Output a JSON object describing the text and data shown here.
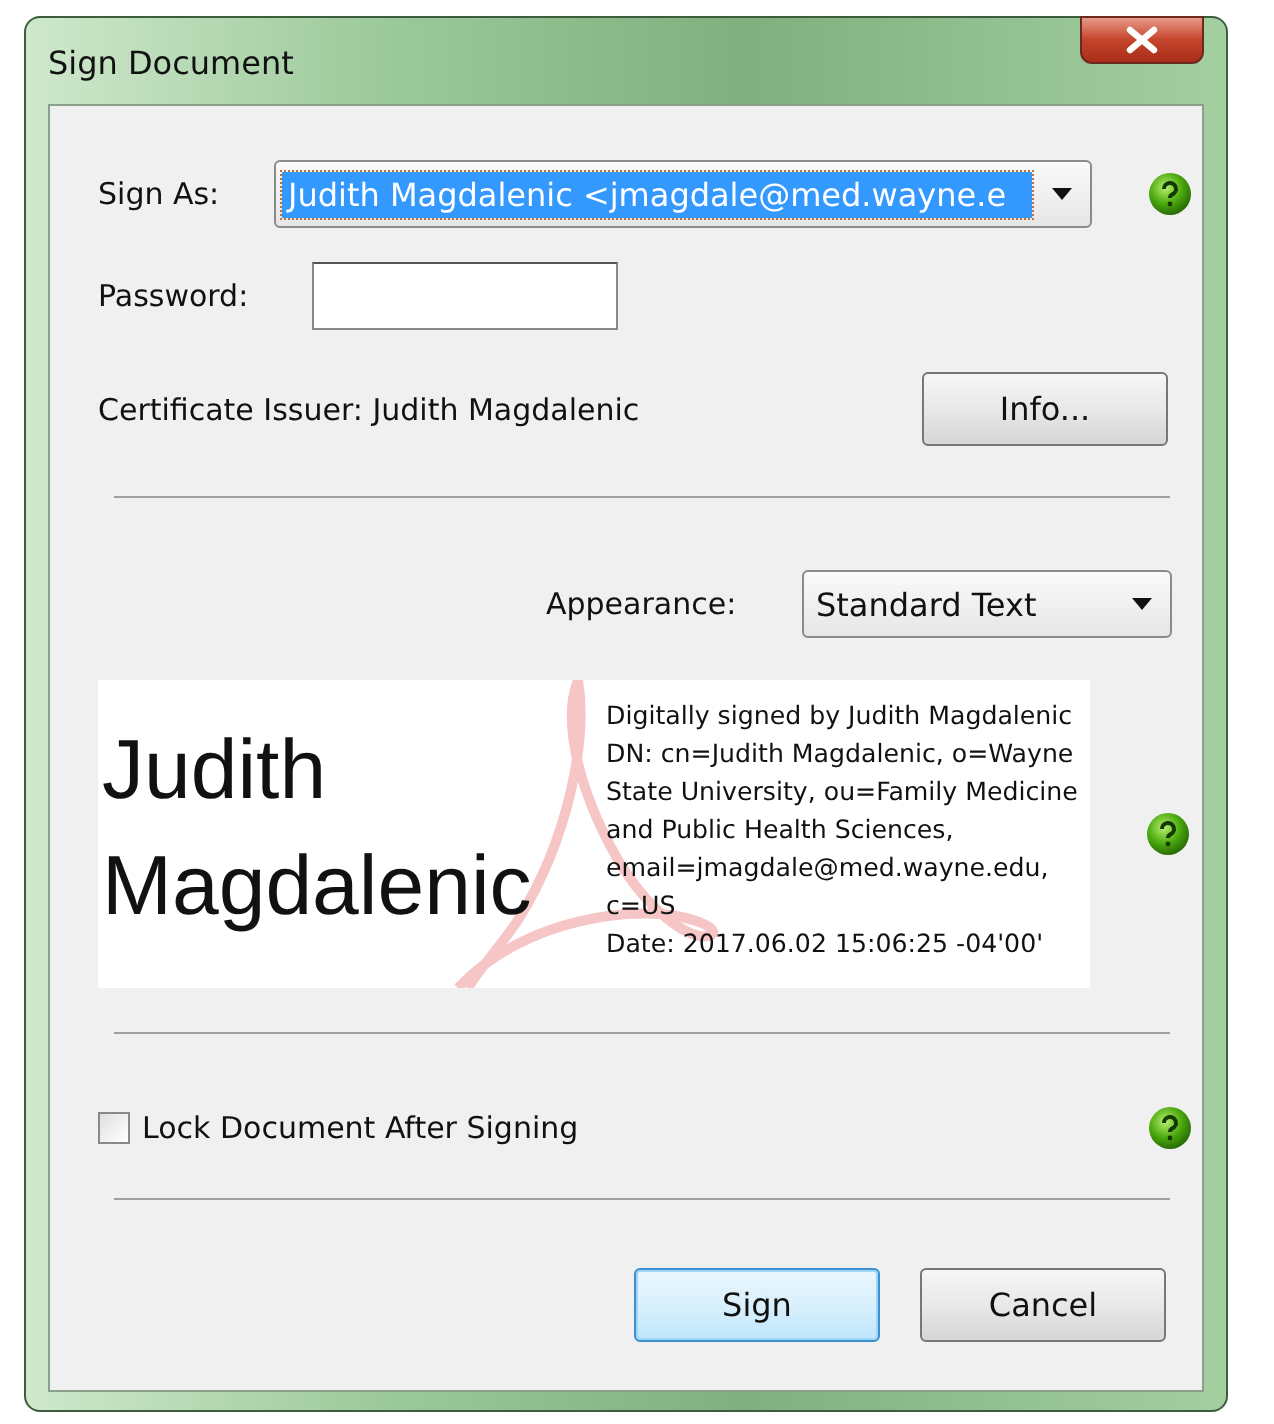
{
  "window": {
    "title": "Sign Document"
  },
  "sign_as": {
    "label": "Sign As:",
    "value": "Judith Magdalenic <jmagdale@med.wayne.e",
    "selected": true
  },
  "password": {
    "label": "Password:"
  },
  "certificate_issuer": "Certificate Issuer: Judith Magdalenic",
  "info_button": "Info...",
  "appearance": {
    "label": "Appearance:",
    "value": "Standard Text"
  },
  "signature_preview": {
    "name_lines": [
      "Judith",
      "Magdalenic"
    ],
    "details": [
      "Digitally signed by Judith Magdalenic",
      "DN: cn=Judith Magdalenic, o=Wayne",
      "State University, ou=Family Medicine",
      "and Public Health Sciences,",
      "email=jmagdale@med.wayne.edu,",
      "c=US",
      "Date: 2017.06.02 15:06:25 -04'00'"
    ]
  },
  "lock_document": {
    "label": "Lock Document After Signing",
    "checked": false
  },
  "buttons": [
    {
      "label": "Sign",
      "default": true
    },
    {
      "label": "Cancel",
      "default": false
    }
  ]
}
